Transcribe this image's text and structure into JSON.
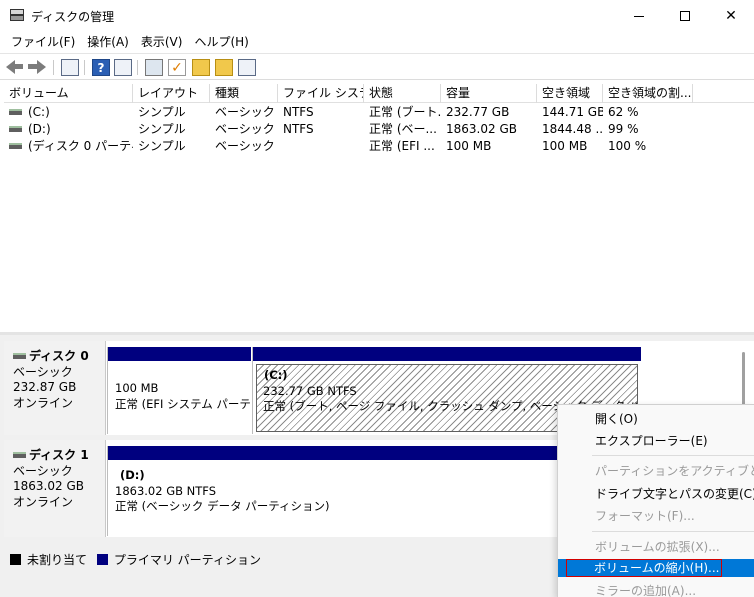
{
  "window": {
    "title": "ディスクの管理"
  },
  "menu": [
    "ファイル(F)",
    "操作(A)",
    "表示(V)",
    "ヘルプ(H)"
  ],
  "volume_list": {
    "columns": [
      "ボリューム",
      "レイアウト",
      "種類",
      "ファイル システム",
      "状態",
      "容量",
      "空き領域",
      "空き領域の割..."
    ],
    "rows": [
      [
        "(C:)",
        "シンプル",
        "ベーシック",
        "NTFS",
        "正常 (ブート...",
        "232.77 GB",
        "144.71 GB",
        "62 %"
      ],
      [
        "(D:)",
        "シンプル",
        "ベーシック",
        "NTFS",
        "正常 (ベー...",
        "1863.02 GB",
        "1844.48 ...",
        "99 %"
      ],
      [
        "(ディスク 0 パーティシ...",
        "シンプル",
        "ベーシック",
        "",
        "正常 (EFI ...",
        "100 MB",
        "100 MB",
        "100 %"
      ]
    ]
  },
  "disks": [
    {
      "name": "ディスク 0",
      "type": "ベーシック",
      "size": "232.87 GB",
      "status": "オンライン",
      "partitions": [
        {
          "name": "",
          "size": "100 MB",
          "status": "正常 (EFI システム パーティション)"
        },
        {
          "name": "(C:)",
          "size": "232.77 GB NTFS",
          "status": "正常 (ブート, ページ ファイル, クラッシュ ダンプ, ベーシック データ パーティション)"
        }
      ]
    },
    {
      "name": "ディスク 1",
      "type": "ベーシック",
      "size": "1863.02 GB",
      "status": "オンライン",
      "partitions": [
        {
          "name": "(D:)",
          "size": "1863.02 GB NTFS",
          "status": "正常 (ベーシック データ パーティション)"
        }
      ]
    }
  ],
  "legend": {
    "unallocated": "未割り当て",
    "primary": "プライマリ パーティション"
  },
  "context_menu": {
    "open": "開く(O)",
    "explorer": "エクスプローラー(E)",
    "mark_active": "パーティションをアクティブとしてマーク",
    "change_letter": "ドライブ文字とパスの変更(C)...",
    "format": "フォーマット(F)...",
    "extend": "ボリュームの拡張(X)...",
    "shrink": "ボリュームの縮小(H)...",
    "add_mirror": "ミラーの追加(A)..."
  },
  "colors": {
    "primary_partition": "#00007f",
    "highlight": "#0078d7",
    "highlight_border": "#d20000"
  }
}
